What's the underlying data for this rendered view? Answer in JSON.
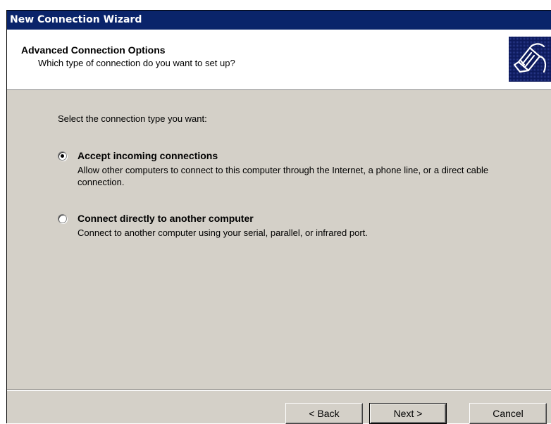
{
  "window": {
    "title": "New Connection Wizard"
  },
  "header": {
    "title": "Advanced Connection Options",
    "subtitle": "Which type of connection do you want to set up?",
    "icon": "network-cable-icon"
  },
  "main": {
    "prompt": "Select the connection type you want:",
    "options": [
      {
        "label": "Accept incoming connections",
        "description": "Allow other computers to connect to this computer through the Internet, a phone line, or a direct cable connection.",
        "selected": true
      },
      {
        "label": "Connect directly to another computer",
        "description": "Connect to another computer using your serial, parallel, or infrared port.",
        "selected": false
      }
    ]
  },
  "footer": {
    "back_label": "< Back",
    "next_label": "Next >",
    "cancel_label": "Cancel"
  },
  "colors": {
    "titlebar": "#0a246a",
    "dialog_face": "#d4d0c8",
    "header_bg": "#ffffff",
    "icon_bg": "#0d1a5c"
  }
}
